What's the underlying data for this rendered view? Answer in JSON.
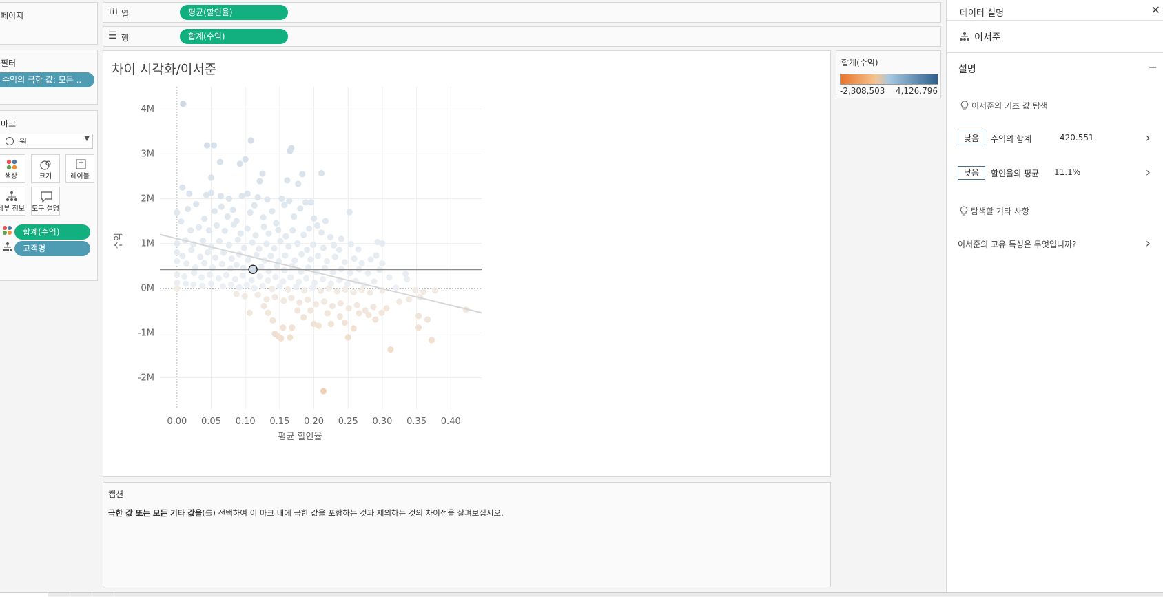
{
  "left_shelf": {
    "pages_title": "페이지",
    "filters_title": "필터",
    "filter_pill": "수익의 극한 값: 모든 ..",
    "marks_title": "마크",
    "mark_type": "원",
    "mark_buttons": [
      "색상",
      "크기",
      "레이블",
      "세부 정보",
      "도구 설명"
    ],
    "mark_pills": [
      "합계(수익)",
      "고객명"
    ]
  },
  "shelves": {
    "columns_label": "열",
    "columns_pill": "평균(할인율)",
    "rows_label": "행",
    "rows_pill": "합계(수익)"
  },
  "viz": {
    "title": "차이 시각화/이서준",
    "caption_title": "캡션",
    "caption_bold": "극한 값 또는 모든 기타 값을",
    "caption_rest": "(를) 선택하여 이 마크 내에 극한 값을 포함하는 것과 제외하는 것의 차이점을 살펴보십시오."
  },
  "legend": {
    "title": "합계(수익)",
    "min": "-2,308,503",
    "max": "4,126,796",
    "colors": [
      "#e8742a",
      "#f7c48f",
      "#a7c8df",
      "#2d5f8e"
    ]
  },
  "chart_data": {
    "type": "scatter",
    "title": "",
    "xlabel": "평균 할인율",
    "ylabel": "수익",
    "x_ticks": [
      "0.00",
      "0.05",
      "0.10",
      "0.15",
      "0.20",
      "0.25",
      "0.30",
      "0.35",
      "0.40"
    ],
    "y_ticks": [
      "4M",
      "3M",
      "2M",
      "1M",
      "0M",
      "-1M",
      "-2M"
    ],
    "xlim": [
      -0.025,
      0.445
    ],
    "ylim": [
      -2.7,
      4.5
    ],
    "selected_point": {
      "x": 0.111,
      "y": 0.42
    },
    "reference_line_y": 0.42,
    "trend_line": [
      {
        "x": -0.025,
        "y": 1.2
      },
      {
        "x": 0.445,
        "y": -0.55
      }
    ],
    "points": [
      [
        0.009,
        4.12
      ],
      [
        0.044,
        3.19
      ],
      [
        0.054,
        3.19
      ],
      [
        0.108,
        3.3
      ],
      [
        0.165,
        3.07
      ],
      [
        0.167,
        3.13
      ],
      [
        0.092,
        2.78
      ],
      [
        0.1,
        2.88
      ],
      [
        0.063,
        2.82
      ],
      [
        0.121,
        2.39
      ],
      [
        0.125,
        2.56
      ],
      [
        0.183,
        2.55
      ],
      [
        0.211,
        2.57
      ],
      [
        0.05,
        2.47
      ],
      [
        0.161,
        2.41
      ],
      [
        0.177,
        2.33
      ],
      [
        0.008,
        2.25
      ],
      [
        0.018,
        2.11
      ],
      [
        0.043,
        2.08
      ],
      [
        0.05,
        2.13
      ],
      [
        0.064,
        2.06
      ],
      [
        0.076,
        2.0
      ],
      [
        0.095,
        2.06
      ],
      [
        0.103,
        2.11
      ],
      [
        0.118,
        2.03
      ],
      [
        0.132,
        1.98
      ],
      [
        0.153,
        2.0
      ],
      [
        0.164,
        1.95
      ],
      [
        0.188,
        1.92
      ],
      [
        0.196,
        1.92
      ],
      [
        0.252,
        1.7
      ],
      [
        0.0,
        1.69
      ],
      [
        0.016,
        1.77
      ],
      [
        0.028,
        1.88
      ],
      [
        0.04,
        1.55
      ],
      [
        0.055,
        1.72
      ],
      [
        0.065,
        1.82
      ],
      [
        0.074,
        1.6
      ],
      [
        0.082,
        1.75
      ],
      [
        0.087,
        1.5
      ],
      [
        0.107,
        1.69
      ],
      [
        0.113,
        1.85
      ],
      [
        0.126,
        1.58
      ],
      [
        0.139,
        1.72
      ],
      [
        0.145,
        1.45
      ],
      [
        0.157,
        1.86
      ],
      [
        0.171,
        1.6
      ],
      [
        0.18,
        1.78
      ],
      [
        0.2,
        1.56
      ],
      [
        0.205,
        1.4
      ],
      [
        0.217,
        1.5
      ],
      [
        0.006,
        1.49
      ],
      [
        0.02,
        1.29
      ],
      [
        0.032,
        1.36
      ],
      [
        0.047,
        1.29
      ],
      [
        0.058,
        1.4
      ],
      [
        0.07,
        1.28
      ],
      [
        0.083,
        1.42
      ],
      [
        0.093,
        1.22
      ],
      [
        0.103,
        1.33
      ],
      [
        0.115,
        1.18
      ],
      [
        0.127,
        1.37
      ],
      [
        0.134,
        1.22
      ],
      [
        0.148,
        1.3
      ],
      [
        0.159,
        1.16
      ],
      [
        0.169,
        1.29
      ],
      [
        0.185,
        1.19
      ],
      [
        0.193,
        1.33
      ],
      [
        0.211,
        1.24
      ],
      [
        0.224,
        1.14
      ],
      [
        0.24,
        1.1
      ],
      [
        0.0,
        1.0
      ],
      [
        0.012,
        1.07
      ],
      [
        0.024,
        0.98
      ],
      [
        0.038,
        1.06
      ],
      [
        0.05,
        0.92
      ],
      [
        0.062,
        1.05
      ],
      [
        0.076,
        0.96
      ],
      [
        0.089,
        1.08
      ],
      [
        0.098,
        0.9
      ],
      [
        0.11,
        1.02
      ],
      [
        0.12,
        0.88
      ],
      [
        0.131,
        0.99
      ],
      [
        0.142,
        0.89
      ],
      [
        0.151,
        1.05
      ],
      [
        0.163,
        0.93
      ],
      [
        0.176,
        1.0
      ],
      [
        0.19,
        0.86
      ],
      [
        0.199,
        0.97
      ],
      [
        0.214,
        0.9
      ],
      [
        0.229,
        0.96
      ],
      [
        0.237,
        0.86
      ],
      [
        0.254,
        0.98
      ],
      [
        0.265,
        0.87
      ],
      [
        0.293,
        1.03
      ],
      [
        0.3,
        1.0
      ],
      [
        0.0,
        0.8
      ],
      [
        0.008,
        0.72
      ],
      [
        0.021,
        0.85
      ],
      [
        0.034,
        0.7
      ],
      [
        0.045,
        0.8
      ],
      [
        0.056,
        0.68
      ],
      [
        0.068,
        0.79
      ],
      [
        0.08,
        0.66
      ],
      [
        0.091,
        0.76
      ],
      [
        0.104,
        0.63
      ],
      [
        0.116,
        0.74
      ],
      [
        0.128,
        0.62
      ],
      [
        0.137,
        0.72
      ],
      [
        0.149,
        0.6
      ],
      [
        0.158,
        0.73
      ],
      [
        0.172,
        0.62
      ],
      [
        0.182,
        0.76
      ],
      [
        0.195,
        0.64
      ],
      [
        0.206,
        0.72
      ],
      [
        0.219,
        0.6
      ],
      [
        0.231,
        0.7
      ],
      [
        0.245,
        0.58
      ],
      [
        0.259,
        0.66
      ],
      [
        0.27,
        0.56
      ],
      [
        0.283,
        0.64
      ],
      [
        0.291,
        0.73
      ],
      [
        0.3,
        0.55
      ],
      [
        0.0,
        0.6
      ],
      [
        0.014,
        0.55
      ],
      [
        0.027,
        0.46
      ],
      [
        0.04,
        0.56
      ],
      [
        0.052,
        0.46
      ],
      [
        0.066,
        0.54
      ],
      [
        0.078,
        0.44
      ],
      [
        0.087,
        0.52
      ],
      [
        0.097,
        0.45
      ],
      [
        0.123,
        0.48
      ],
      [
        0.134,
        0.38
      ],
      [
        0.146,
        0.5
      ],
      [
        0.157,
        0.4
      ],
      [
        0.168,
        0.49
      ],
      [
        0.181,
        0.37
      ],
      [
        0.192,
        0.46
      ],
      [
        0.204,
        0.36
      ],
      [
        0.216,
        0.45
      ],
      [
        0.228,
        0.35
      ],
      [
        0.24,
        0.43
      ],
      [
        0.253,
        0.34
      ],
      [
        0.266,
        0.42
      ],
      [
        0.279,
        0.33
      ],
      [
        0.296,
        0.41
      ],
      [
        0.0,
        0.3
      ],
      [
        0.011,
        0.26
      ],
      [
        0.025,
        0.34
      ],
      [
        0.036,
        0.24
      ],
      [
        0.048,
        0.3
      ],
      [
        0.061,
        0.22
      ],
      [
        0.072,
        0.29
      ],
      [
        0.085,
        0.2
      ],
      [
        0.096,
        0.28
      ],
      [
        0.109,
        0.18
      ],
      [
        0.121,
        0.26
      ],
      [
        0.133,
        0.17
      ],
      [
        0.144,
        0.25
      ],
      [
        0.155,
        0.15
      ],
      [
        0.166,
        0.24
      ],
      [
        0.178,
        0.14
      ],
      [
        0.189,
        0.22
      ],
      [
        0.201,
        0.12
      ],
      [
        0.213,
        0.2
      ],
      [
        0.225,
        0.1
      ],
      [
        0.237,
        0.18
      ],
      [
        0.249,
        0.09
      ],
      [
        0.261,
        0.16
      ],
      [
        0.273,
        0.08
      ],
      [
        0.288,
        0.15
      ],
      [
        0.31,
        0.24
      ],
      [
        0.334,
        0.32
      ],
      [
        0.336,
        0.2
      ],
      [
        0.0,
        0.12
      ],
      [
        0.013,
        0.1
      ],
      [
        0.024,
        0.08
      ],
      [
        0.037,
        0.05
      ],
      [
        0.05,
        0.1
      ],
      [
        0.067,
        0.04
      ],
      [
        0.079,
        0.08
      ],
      [
        0.091,
        0.02
      ],
      [
        0.102,
        0.07
      ],
      [
        0.113,
        0.0
      ],
      [
        0.125,
        0.05
      ],
      [
        0.139,
        -0.02
      ],
      [
        0.15,
        0.04
      ],
      [
        0.162,
        -0.03
      ],
      [
        0.174,
        0.03
      ],
      [
        0.186,
        -0.05
      ],
      [
        0.198,
        0.01
      ],
      [
        0.21,
        -0.06
      ],
      [
        0.222,
        -0.01
      ],
      [
        0.234,
        -0.07
      ],
      [
        0.246,
        -0.03
      ],
      [
        0.258,
        -0.09
      ],
      [
        0.27,
        -0.04
      ],
      [
        0.282,
        -0.1
      ],
      [
        0.3,
        -0.05
      ],
      [
        0.32,
        0.01
      ],
      [
        0.348,
        -0.05
      ],
      [
        0.36,
        -0.08
      ],
      [
        0.377,
        -0.05
      ],
      [
        0.0,
        -0.01
      ],
      [
        0.087,
        -0.13
      ],
      [
        0.099,
        -0.18
      ],
      [
        0.118,
        -0.15
      ],
      [
        0.131,
        -0.25
      ],
      [
        0.143,
        -0.2
      ],
      [
        0.156,
        -0.28
      ],
      [
        0.167,
        -0.22
      ],
      [
        0.179,
        -0.32
      ],
      [
        0.191,
        -0.26
      ],
      [
        0.203,
        -0.36
      ],
      [
        0.215,
        -0.3
      ],
      [
        0.227,
        -0.4
      ],
      [
        0.239,
        -0.34
      ],
      [
        0.251,
        -0.45
      ],
      [
        0.263,
        -0.38
      ],
      [
        0.275,
        -0.5
      ],
      [
        0.287,
        -0.42
      ],
      [
        0.299,
        -0.55
      ],
      [
        0.306,
        -0.45
      ],
      [
        0.325,
        -0.3
      ],
      [
        0.339,
        -0.25
      ],
      [
        0.355,
        -0.2
      ],
      [
        0.353,
        -0.62
      ],
      [
        0.366,
        -0.7
      ],
      [
        0.353,
        -0.88
      ],
      [
        0.372,
        -1.16
      ],
      [
        0.422,
        -0.48
      ],
      [
        0.312,
        -1.37
      ],
      [
        0.106,
        -0.55
      ],
      [
        0.14,
        -0.72
      ],
      [
        0.155,
        -0.88
      ],
      [
        0.168,
        -0.88
      ],
      [
        0.143,
        -1.02
      ],
      [
        0.148,
        -1.08
      ],
      [
        0.152,
        -1.12
      ],
      [
        0.165,
        -1.1
      ],
      [
        0.207,
        -0.84
      ],
      [
        0.225,
        -0.8
      ],
      [
        0.245,
        -0.77
      ],
      [
        0.25,
        -1.1
      ],
      [
        0.258,
        -0.9
      ],
      [
        0.214,
        -2.3
      ],
      [
        0.2,
        -0.8
      ],
      [
        0.185,
        -0.65
      ],
      [
        0.22,
        -0.56
      ],
      [
        0.238,
        -0.63
      ],
      [
        0.266,
        -0.56
      ],
      [
        0.28,
        -0.6
      ],
      [
        0.29,
        -0.7
      ],
      [
        0.195,
        -0.5
      ],
      [
        0.127,
        -0.4
      ],
      [
        0.133,
        -0.55
      ],
      [
        0.176,
        -0.5
      ]
    ]
  },
  "data_guide": {
    "header_title": "데이터 설명",
    "subject_name": "이서준",
    "section_title": "설명",
    "explore_label": "이서준의 기초 값 탐색",
    "items": [
      {
        "badge": "낮음",
        "label": "수익의 합계",
        "value": "420.551"
      },
      {
        "badge": "낮음",
        "label": "할인율의 평균",
        "value": "11.1%"
      }
    ],
    "other_label": "탐색할 기타 사항",
    "question": "이서준의 고유 특성은 무엇입니까?"
  }
}
